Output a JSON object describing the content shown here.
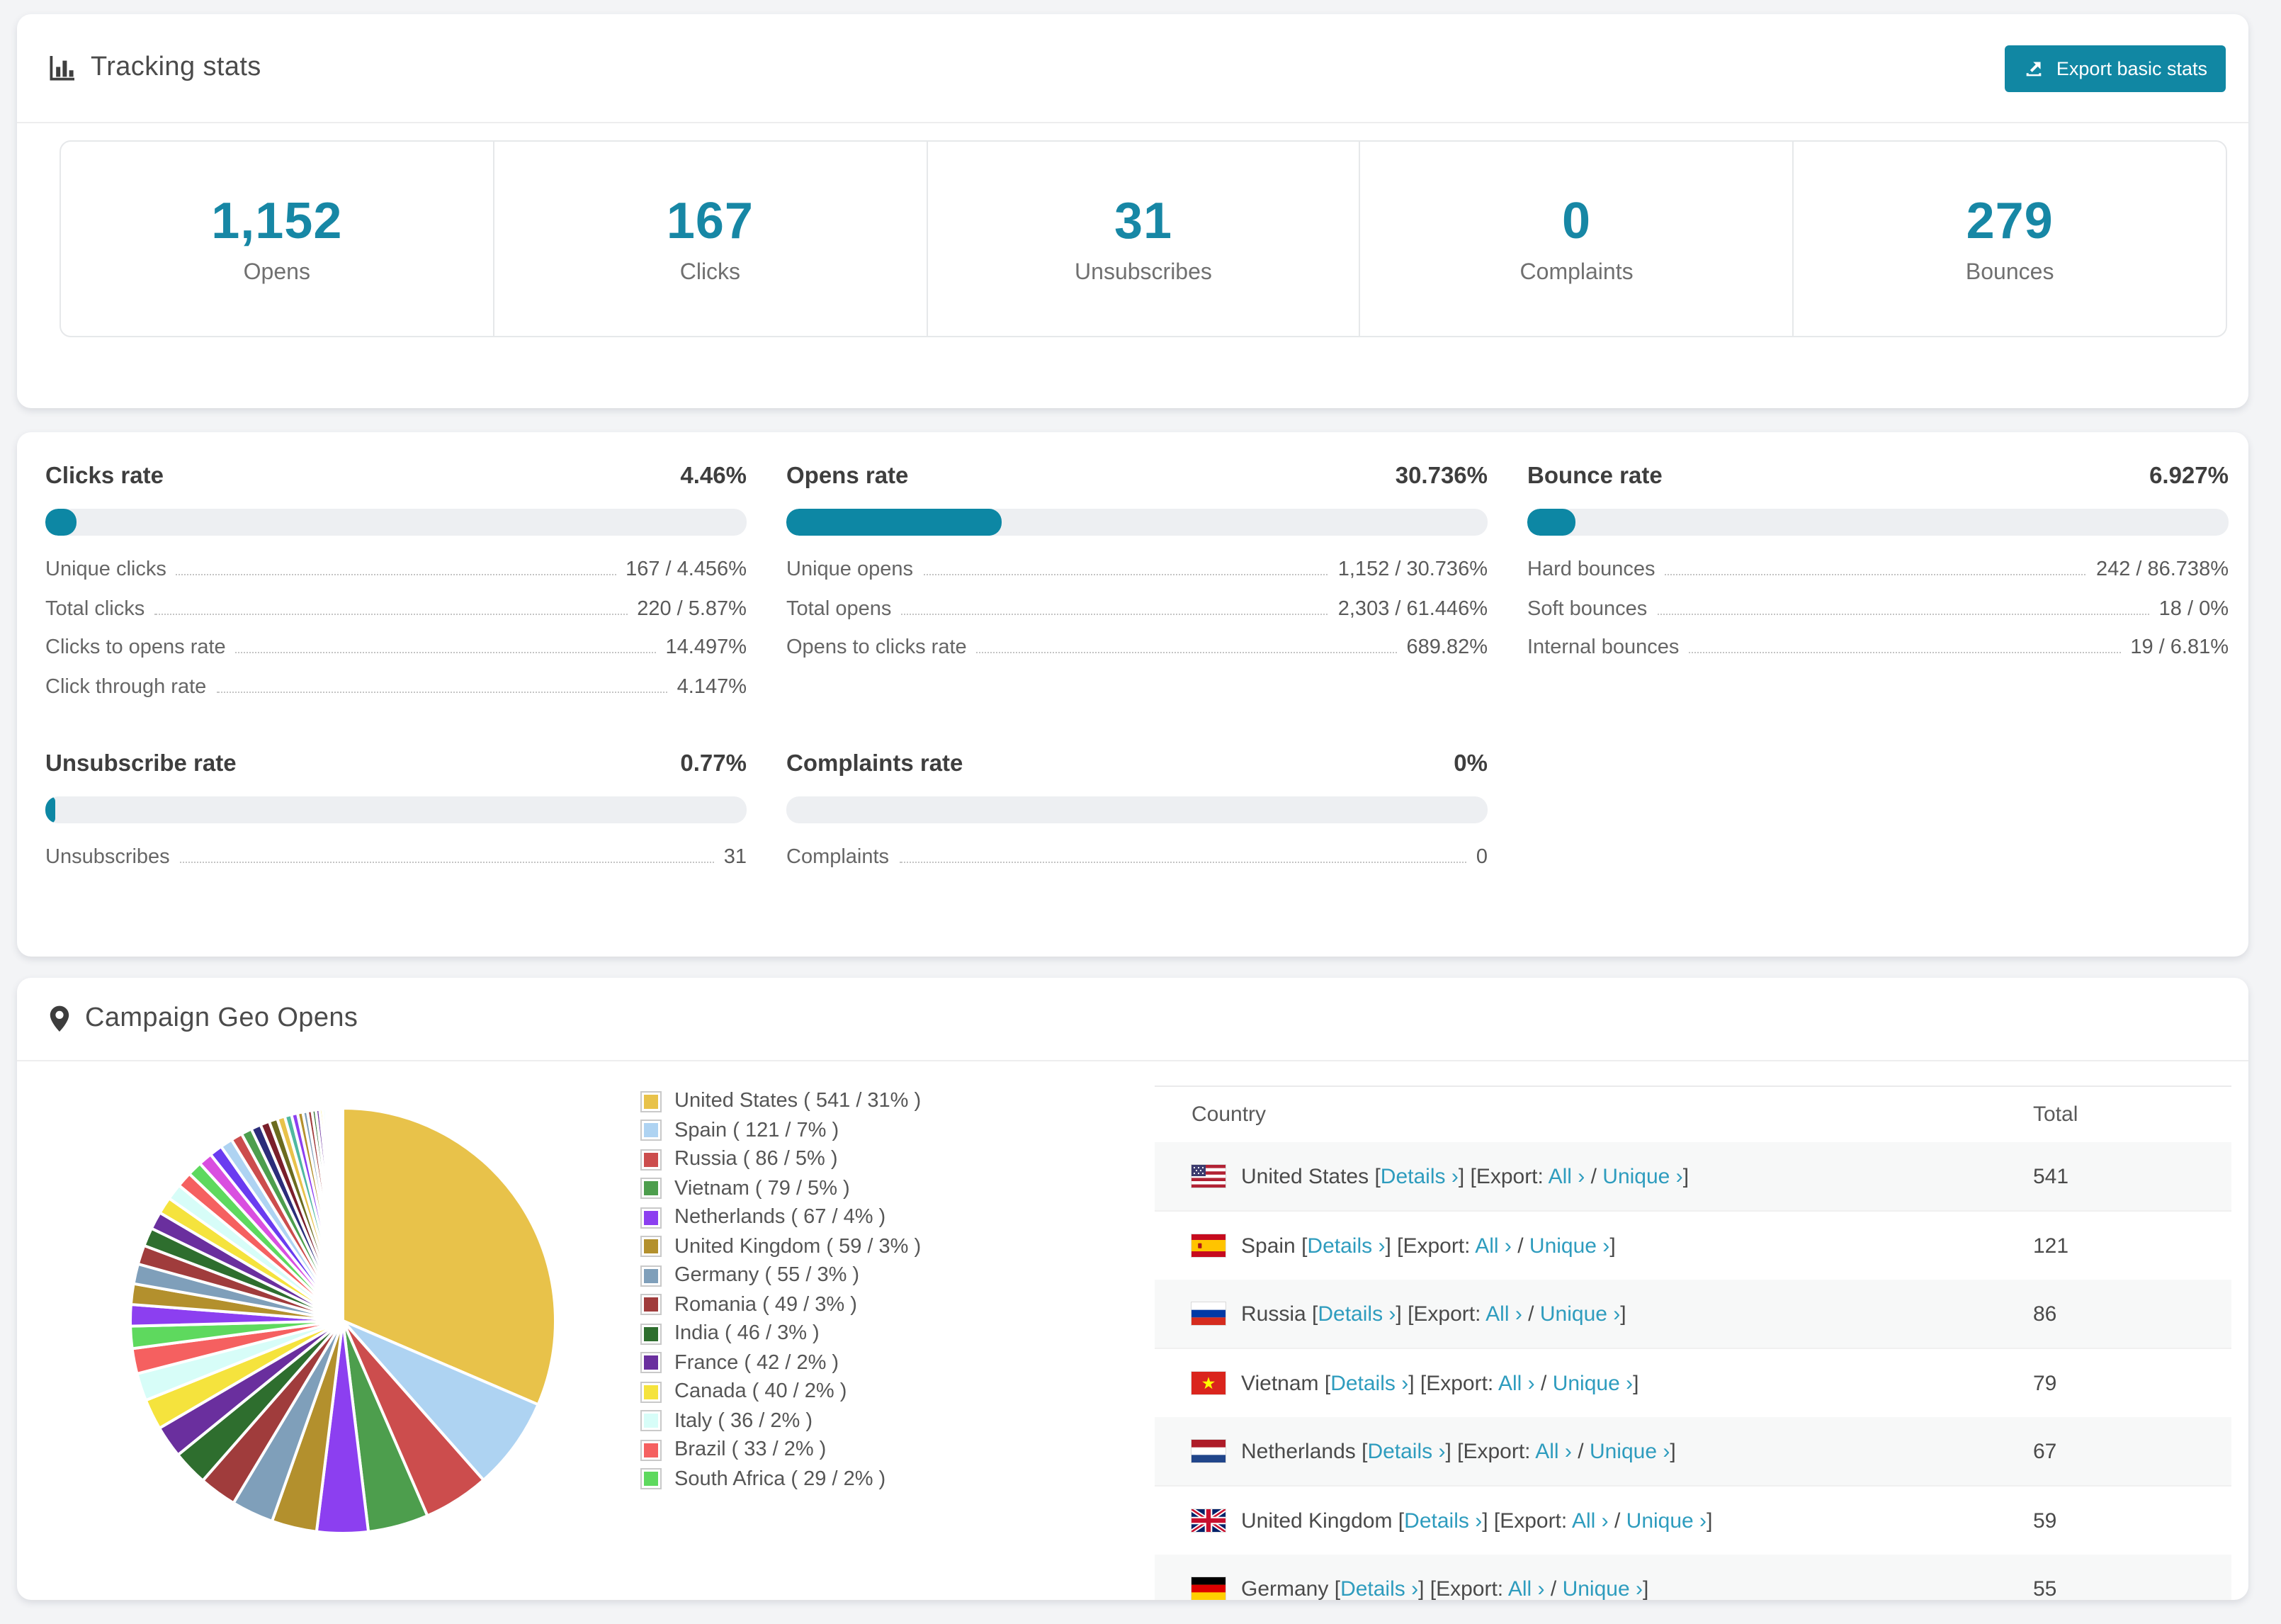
{
  "tracking": {
    "title": "Tracking stats",
    "export_button": "Export basic stats",
    "stats": [
      {
        "value": "1,152",
        "label": "Opens"
      },
      {
        "value": "167",
        "label": "Clicks"
      },
      {
        "value": "31",
        "label": "Unsubscribes"
      },
      {
        "value": "0",
        "label": "Complaints"
      },
      {
        "value": "279",
        "label": "Bounces"
      }
    ]
  },
  "rates": {
    "blocks": [
      {
        "title": "Clicks rate",
        "value": "4.46%",
        "bar_pct": 4.46,
        "rows": [
          {
            "label": "Unique clicks",
            "value": "167 / 4.456%"
          },
          {
            "label": "Total clicks",
            "value": "220 / 5.87%"
          },
          {
            "label": "Clicks to opens rate",
            "value": "14.497%"
          },
          {
            "label": "Click through rate",
            "value": "4.147%"
          }
        ]
      },
      {
        "title": "Opens rate",
        "value": "30.736%",
        "bar_pct": 30.736,
        "rows": [
          {
            "label": "Unique opens",
            "value": "1,152 / 30.736%"
          },
          {
            "label": "Total opens",
            "value": "2,303 / 61.446%"
          },
          {
            "label": "Opens to clicks rate",
            "value": "689.82%"
          }
        ]
      },
      {
        "title": "Bounce rate",
        "value": "6.927%",
        "bar_pct": 6.927,
        "rows": [
          {
            "label": "Hard bounces",
            "value": "242 / 86.738%"
          },
          {
            "label": "Soft bounces",
            "value": "18 / 0%"
          },
          {
            "label": "Internal bounces",
            "value": "19 / 6.81%"
          }
        ]
      },
      {
        "title": "Unsubscribe rate",
        "value": "0.77%",
        "bar_pct": 0.77,
        "rows": [
          {
            "label": "Unsubscribes",
            "value": "31"
          }
        ]
      },
      {
        "title": "Complaints rate",
        "value": "0%",
        "bar_pct": 0,
        "rows": [
          {
            "label": "Complaints",
            "value": "0"
          }
        ]
      }
    ]
  },
  "geo": {
    "title": "Campaign Geo Opens",
    "chart_data": {
      "type": "pie",
      "title": "Campaign Geo Opens",
      "start_angle": "top",
      "direction": "clockwise",
      "legend_position": "right",
      "slices": [
        {
          "name": "United States",
          "value": 541,
          "pct": "31%",
          "color": "#e8c24a",
          "label": "United States ( 541 / 31% )"
        },
        {
          "name": "Spain",
          "value": 121,
          "pct": "7%",
          "color": "#aed3f2",
          "label": "Spain ( 121 / 7% )"
        },
        {
          "name": "Russia",
          "value": 86,
          "pct": "5%",
          "color": "#cc4d4d",
          "label": "Russia ( 86 / 5% )"
        },
        {
          "name": "Vietnam",
          "value": 79,
          "pct": "5%",
          "color": "#4d9e4d",
          "label": "Vietnam ( 79 / 5% )"
        },
        {
          "name": "Netherlands",
          "value": 67,
          "pct": "4%",
          "color": "#8c3ff0",
          "label": "Netherlands ( 67 / 4% )"
        },
        {
          "name": "United Kingdom",
          "value": 59,
          "pct": "3%",
          "color": "#b3902d",
          "label": "United Kingdom ( 59 / 3% )"
        },
        {
          "name": "Germany",
          "value": 55,
          "pct": "3%",
          "color": "#7f9fba",
          "label": "Germany ( 55 / 3% )"
        },
        {
          "name": "Romania",
          "value": 49,
          "pct": "3%",
          "color": "#a03c3c",
          "label": "Romania ( 49 / 3% )"
        },
        {
          "name": "India",
          "value": 46,
          "pct": "3%",
          "color": "#2e6e2e",
          "label": "India ( 46 / 3% )"
        },
        {
          "name": "France",
          "value": 42,
          "pct": "2%",
          "color": "#6a2f9e",
          "label": "France ( 42 / 2% )"
        },
        {
          "name": "Canada",
          "value": 40,
          "pct": "2%",
          "color": "#f5e33d",
          "label": "Canada ( 40 / 2% )"
        },
        {
          "name": "Italy",
          "value": 36,
          "pct": "2%",
          "color": "#d7fdf8",
          "label": "Italy ( 36 / 2% )"
        },
        {
          "name": "Brazil",
          "value": 33,
          "pct": "2%",
          "color": "#f56060",
          "label": "Brazil ( 33 / 2% )"
        },
        {
          "name": "South Africa",
          "value": 29,
          "pct": "2%",
          "color": "#5ed95e",
          "label": "South Africa ( 29 / 2% )"
        }
      ],
      "unlabeled_tail": {
        "values": [
          28,
          27,
          26,
          25,
          24,
          23,
          22,
          21,
          20,
          19,
          18,
          17,
          16,
          15,
          14,
          13,
          12,
          11,
          10,
          9,
          8,
          7,
          6,
          6,
          5,
          5,
          4,
          4,
          3,
          3,
          3,
          2,
          2,
          2,
          2,
          1,
          1,
          1,
          1,
          1
        ],
        "colors": [
          "#8c3ff0",
          "#b3902d",
          "#7f9fba",
          "#a03c3c",
          "#2e6e2e",
          "#6a2f9e",
          "#f5e33d",
          "#d7fdf8",
          "#f56060",
          "#5ed95e",
          "#d94fe0",
          "#6a3cf0",
          "#aed3f2",
          "#cc4d4d",
          "#4d9e4d",
          "#2b2d7a",
          "#7a1f2b",
          "#6b6b1f",
          "#e8c24a",
          "#50b8a0"
        ]
      }
    },
    "table": {
      "headers": [
        "Country",
        "Total"
      ],
      "details_label": "Details ›",
      "export_prefix": "Export:",
      "all_label": "All ›",
      "unique_label": "Unique ›",
      "rows": [
        {
          "flag": "us",
          "country": "United States",
          "total": "541"
        },
        {
          "flag": "es",
          "country": "Spain",
          "total": "121"
        },
        {
          "flag": "ru",
          "country": "Russia",
          "total": "86"
        },
        {
          "flag": "vn",
          "country": "Vietnam",
          "total": "79"
        },
        {
          "flag": "nl",
          "country": "Netherlands",
          "total": "67"
        },
        {
          "flag": "gb",
          "country": "United Kingdom",
          "total": "59"
        },
        {
          "flag": "de",
          "country": "Germany",
          "total": "55"
        }
      ]
    }
  },
  "colors": {
    "accent": "#0d87a4",
    "link": "#2e9cbe",
    "stat_number": "#1787a5"
  }
}
